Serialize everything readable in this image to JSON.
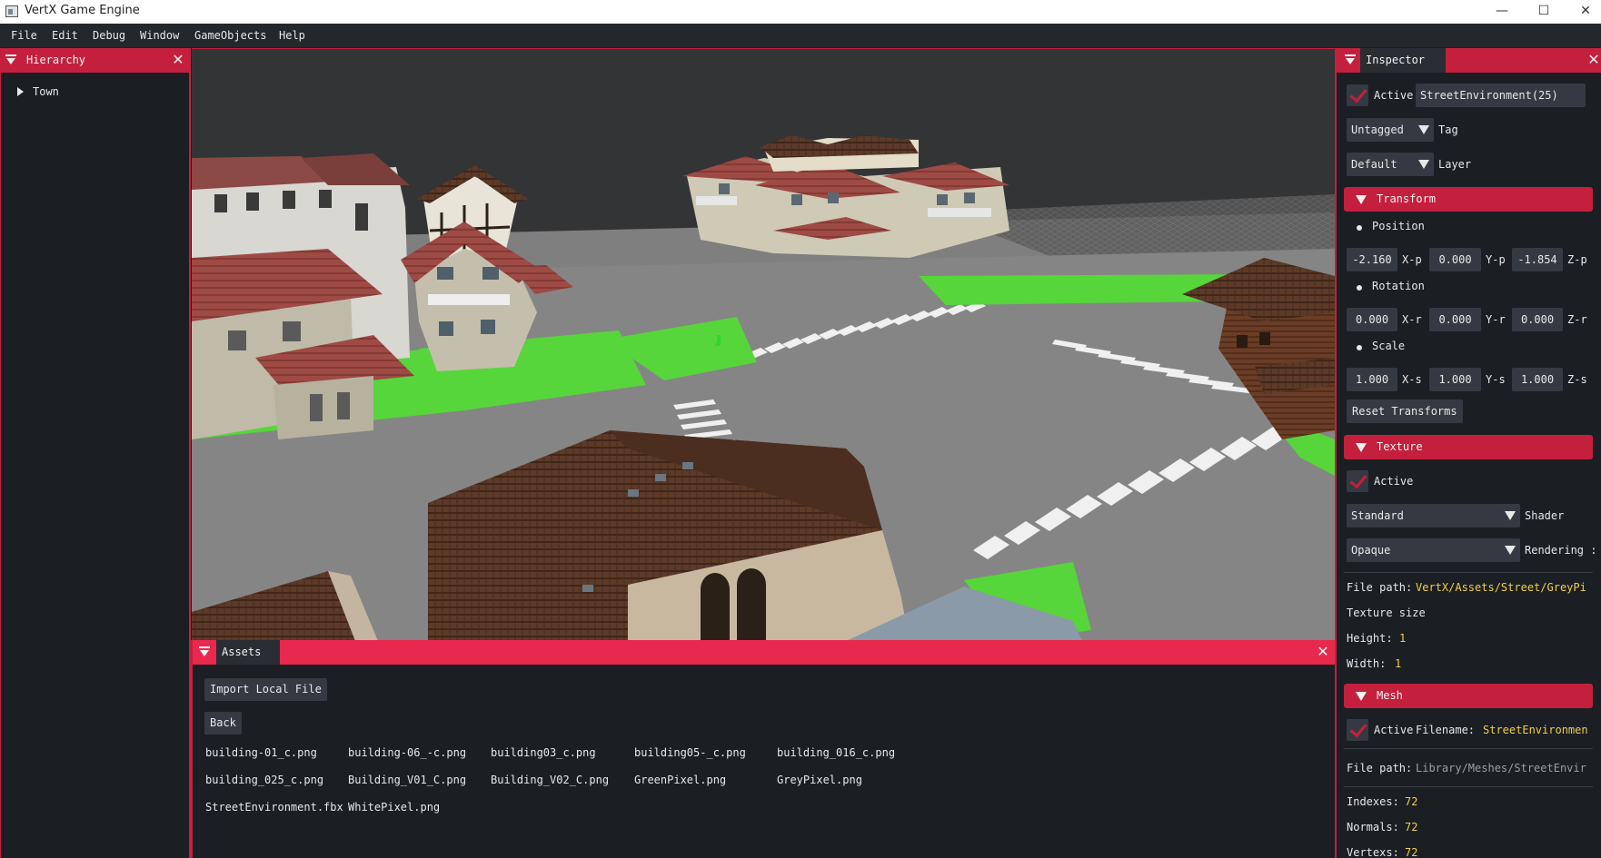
{
  "window": {
    "title": "VertX Game Engine",
    "minimize": "—",
    "maximize": "☐",
    "close": "✕"
  },
  "menubar": [
    "File",
    "Edit",
    "Debug",
    "Window",
    "GameObjects",
    "Help"
  ],
  "hierarchy": {
    "tab": "Hierarchy",
    "nodes": [
      "Town"
    ]
  },
  "assets": {
    "tab": "Assets",
    "import_button": "Import Local File",
    "back_button": "Back",
    "files": [
      "building-01_c.png",
      "building-06_-c.png",
      "building03_c.png",
      "building05-_c.png",
      "building_016_c.png",
      "building_025_c.png",
      "Building_V01_C.png",
      "Building_V02_C.png",
      "GreenPixel.png",
      "GreyPixel.png",
      "StreetEnvironment.fbx",
      "WhitePixel.png"
    ]
  },
  "inspector": {
    "tab": "Inspector",
    "active_label": "Active",
    "object_name": "StreetEnvironment(25)",
    "tag_value": "Untagged",
    "tag_label": "Tag",
    "layer_value": "Default",
    "layer_label": "Layer",
    "transform": {
      "header": "Transform",
      "position_label": "Position",
      "position": [
        "-2.160",
        "0.000",
        "-1.854"
      ],
      "position_axes": [
        "X-p",
        "Y-p",
        "Z-p"
      ],
      "rotation_label": "Rotation",
      "rotation": [
        "0.000",
        "0.000",
        "0.000"
      ],
      "rotation_axes": [
        "X-r",
        "Y-r",
        "Z-r"
      ],
      "scale_label": "Scale",
      "scale": [
        "1.000",
        "1.000",
        "1.000"
      ],
      "scale_axes": [
        "X-s",
        "Y-s",
        "Z-s"
      ],
      "reset_button": "Reset Transforms"
    },
    "texture": {
      "header": "Texture",
      "active_label": "Active",
      "shader_value": "Standard",
      "shader_label": "Shader",
      "rendering_value": "Opaque",
      "rendering_label": "Rendering :",
      "file_path_label": "File path:",
      "file_path": "VertX/Assets/Street/GreyPi",
      "size_label": "Texture size",
      "height_label": "Height:",
      "height": "1",
      "width_label": "Width:",
      "width": "1"
    },
    "mesh": {
      "header": "Mesh",
      "active_label": "Active",
      "filename_label": "Filename:",
      "filename": "StreetEnvironmen",
      "file_path_label": "File path:",
      "file_path": "Library/Meshes/StreetEnvir",
      "indexes_label": "Indexes:",
      "indexes": "72",
      "normals_label": "Normals:",
      "normals": "72",
      "vertexs_label": "Vertexs:",
      "vertexs": "72"
    }
  },
  "colors": {
    "accent": "#c4203e",
    "panel_bg": "#1b1e23",
    "widget_bg": "#353a42",
    "highlight_text": "#f2d04a"
  }
}
